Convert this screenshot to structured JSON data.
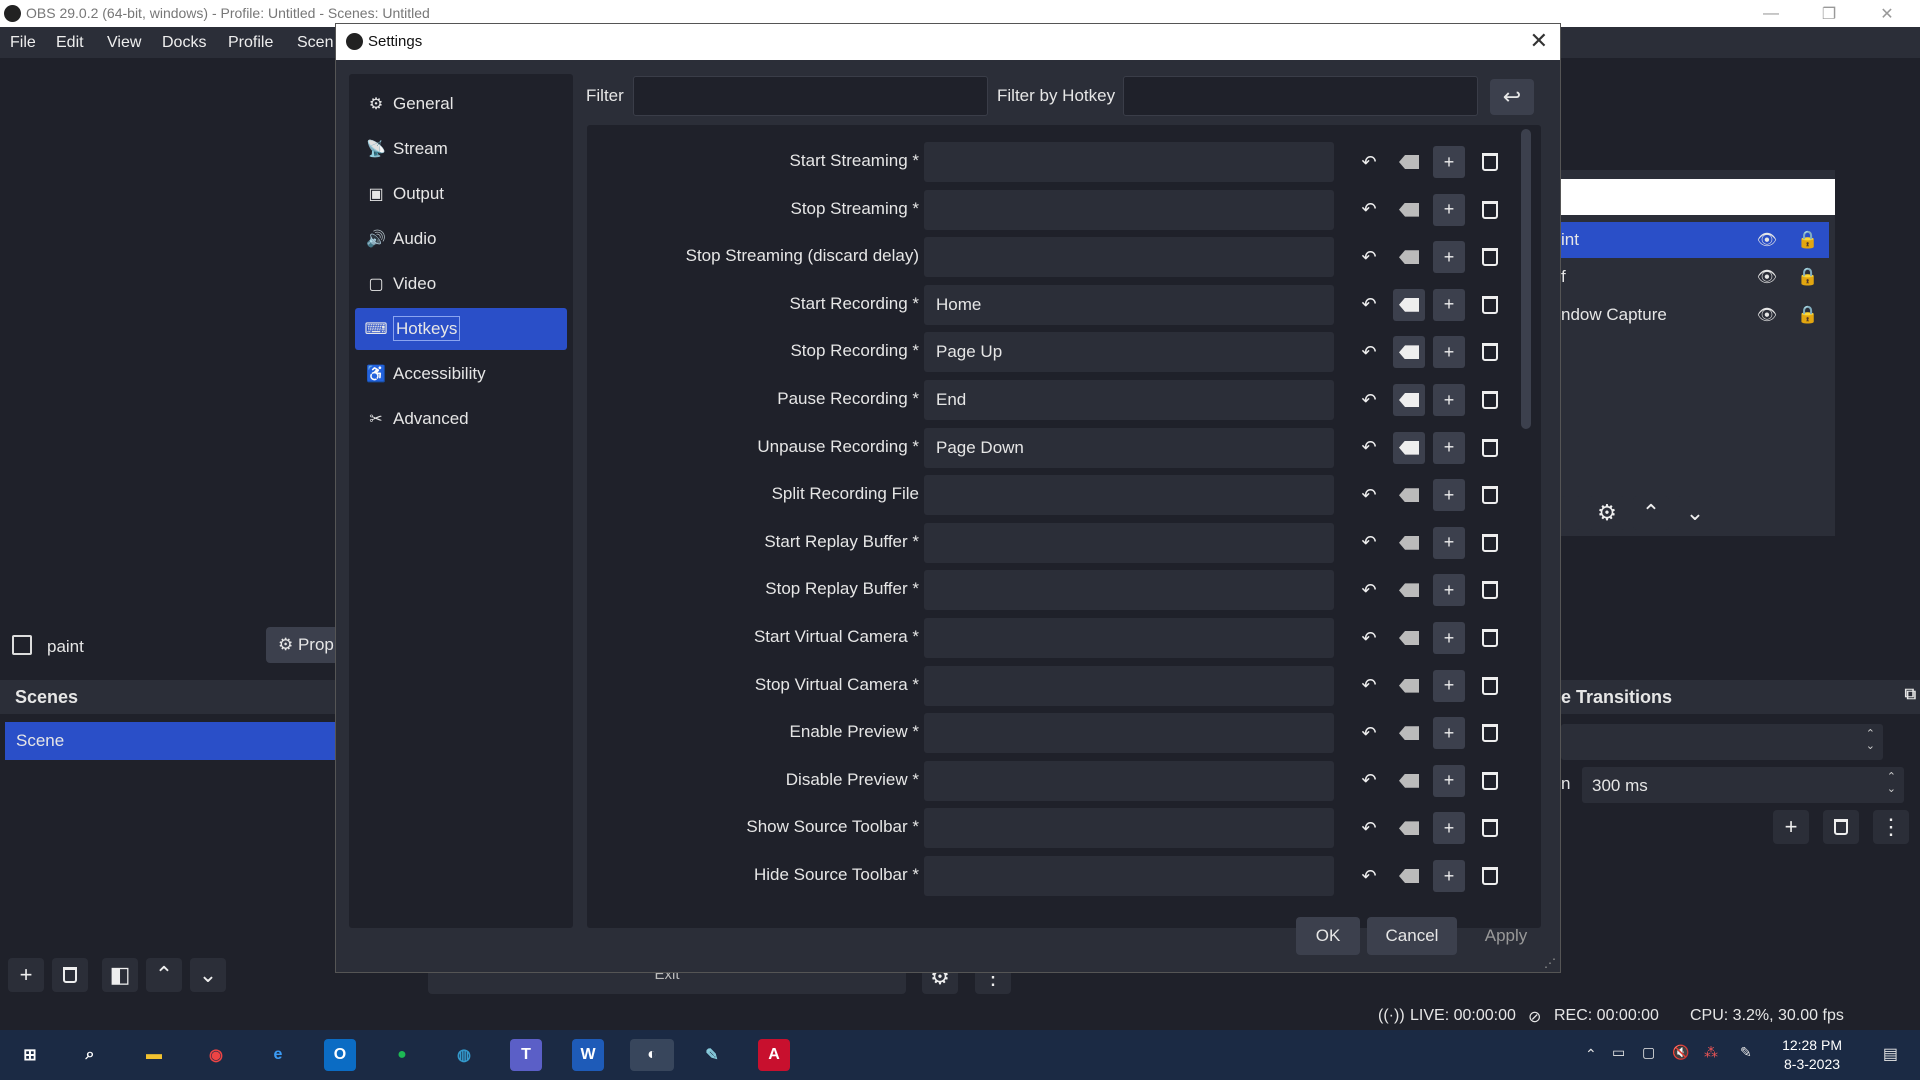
{
  "app": {
    "title": "OBS 29.0.2 (64-bit, windows) - Profile: Untitled - Scenes: Untitled"
  },
  "menu": [
    "File",
    "Edit",
    "View",
    "Docks",
    "Profile",
    "Scen"
  ],
  "left": {
    "source_name": "paint",
    "properties_label": "Prop",
    "scenes_header": "Scenes",
    "scene_item": "Scene"
  },
  "right": {
    "sources": [
      {
        "label": "int",
        "selected": true
      },
      {
        "label": "f",
        "selected": false
      },
      {
        "label": "ndow Capture",
        "selected": false
      }
    ],
    "transitions_header": "e Transitions",
    "duration_label": "n",
    "duration_value": "300 ms"
  },
  "controls": {
    "exit_label": "Exit"
  },
  "status": {
    "live": "LIVE: 00:00:00",
    "rec": "REC: 00:00:00",
    "cpu": "CPU: 3.2%, 30.00 fps"
  },
  "taskbar": {
    "time": "12:28 PM",
    "date": "8-3-2023"
  },
  "settings": {
    "title": "Settings",
    "nav": [
      {
        "label": "General",
        "icon": "gear-icon"
      },
      {
        "label": "Stream",
        "icon": "antenna-icon"
      },
      {
        "label": "Output",
        "icon": "output-icon"
      },
      {
        "label": "Audio",
        "icon": "speaker-icon"
      },
      {
        "label": "Video",
        "icon": "monitor-icon"
      },
      {
        "label": "Hotkeys",
        "icon": "keyboard-icon"
      },
      {
        "label": "Accessibility",
        "icon": "accessibility-icon"
      },
      {
        "label": "Advanced",
        "icon": "tools-icon"
      }
    ],
    "selected_nav": "Hotkeys",
    "filter_label": "Filter",
    "filter_value": "",
    "filter_hotkey_label": "Filter by Hotkey",
    "filter_hotkey_value": "",
    "hotkeys": [
      {
        "name": "Start Streaming *",
        "key": ""
      },
      {
        "name": "Stop Streaming *",
        "key": ""
      },
      {
        "name": "Stop Streaming (discard delay)",
        "key": ""
      },
      {
        "name": "Start Recording *",
        "key": "Home"
      },
      {
        "name": "Stop Recording *",
        "key": "Page Up"
      },
      {
        "name": "Pause Recording *",
        "key": "End"
      },
      {
        "name": "Unpause Recording *",
        "key": "Page Down"
      },
      {
        "name": "Split Recording File",
        "key": ""
      },
      {
        "name": "Start Replay Buffer *",
        "key": ""
      },
      {
        "name": "Stop Replay Buffer *",
        "key": ""
      },
      {
        "name": "Start Virtual Camera *",
        "key": ""
      },
      {
        "name": "Stop Virtual Camera *",
        "key": ""
      },
      {
        "name": "Enable Preview *",
        "key": ""
      },
      {
        "name": "Disable Preview *",
        "key": ""
      },
      {
        "name": "Show Source Toolbar *",
        "key": ""
      },
      {
        "name": "Hide Source Toolbar *",
        "key": ""
      }
    ],
    "ok_label": "OK",
    "cancel_label": "Cancel",
    "apply_label": "Apply"
  },
  "colors": {
    "accent": "#2a4fc8",
    "panel": "#2b2e38",
    "bg": "#1f212a"
  }
}
